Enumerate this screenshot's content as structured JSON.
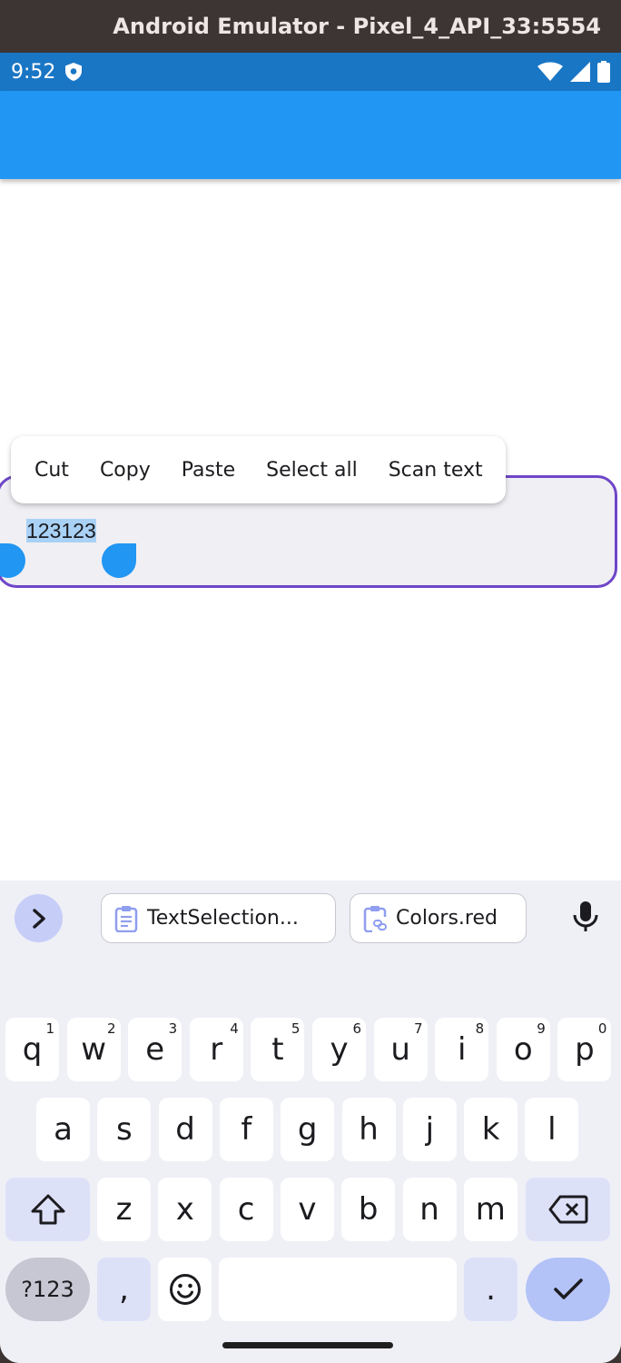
{
  "window": {
    "title": "Android Emulator - Pixel_4_API_33:5554"
  },
  "status_bar": {
    "time": "9:52",
    "icons": [
      "shield-icon",
      "wifi-icon",
      "cell-signal-icon",
      "battery-icon"
    ]
  },
  "text_field": {
    "value": "123123"
  },
  "selection_toolbar": {
    "items": [
      "Cut",
      "Copy",
      "Paste",
      "Select all",
      "Scan text"
    ]
  },
  "keyboard": {
    "suggestions": [
      {
        "icon": "clipboard-icon",
        "label": "TextSelection..."
      },
      {
        "icon": "clipboard-link-icon",
        "label": "Colors.red"
      }
    ],
    "row1": [
      {
        "k": "q",
        "h": "1"
      },
      {
        "k": "w",
        "h": "2"
      },
      {
        "k": "e",
        "h": "3"
      },
      {
        "k": "r",
        "h": "4"
      },
      {
        "k": "t",
        "h": "5"
      },
      {
        "k": "y",
        "h": "6"
      },
      {
        "k": "u",
        "h": "7"
      },
      {
        "k": "i",
        "h": "8"
      },
      {
        "k": "o",
        "h": "9"
      },
      {
        "k": "p",
        "h": "0"
      }
    ],
    "row2": [
      "a",
      "s",
      "d",
      "f",
      "g",
      "h",
      "j",
      "k",
      "l"
    ],
    "row3": [
      "z",
      "x",
      "c",
      "v",
      "b",
      "n",
      "m"
    ],
    "symbols_label": "?123",
    "comma_label": ",",
    "period_label": "."
  },
  "colors": {
    "app_bar": "#2196f3",
    "status_bar": "#1976c4",
    "field_border": "#6e46c8",
    "selection": "#a9d1f5"
  }
}
